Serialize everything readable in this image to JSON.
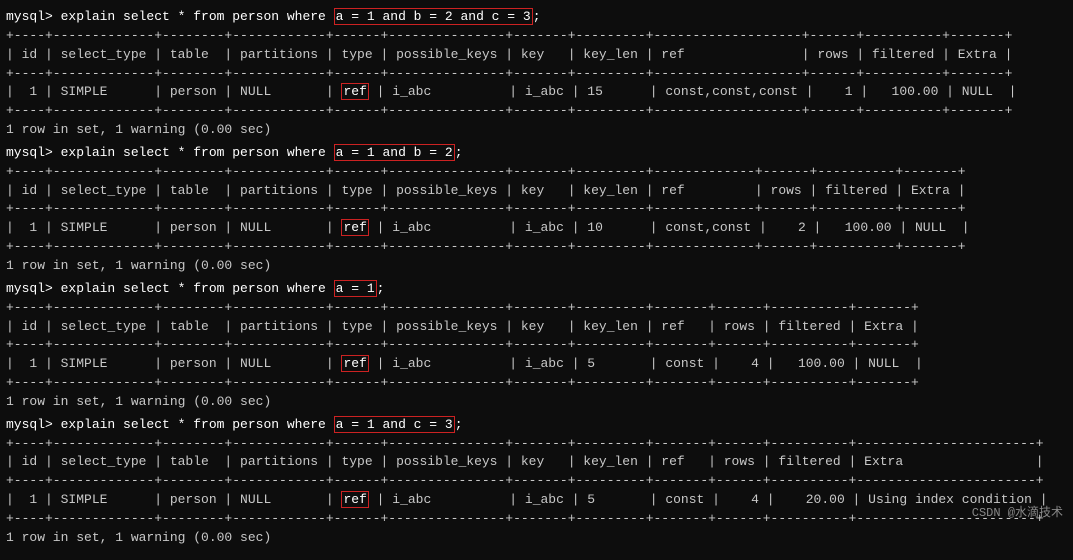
{
  "terminal": {
    "blocks": [
      {
        "id": "block1",
        "prompt": "mysql> explain select * from person where ",
        "highlight": "a = 1 and b = 2 and c = 3",
        "prompt_end": ";",
        "divider_top": "+----+-------------+--------+------------+------+---------------+-------+---------+-------------------+------+----------+-------+",
        "header": "| id | select_type | table  | partitions | type | possible_keys | key   | key_len | ref               | rows | filtered | Extra |",
        "divider_mid": "+----+-------------+--------+------------+------+---------------+-------+---------+-------------------+------+----------+-------+",
        "row_pre": "|  1 | SIMPLE      | person | NULL       | ",
        "ref_val": "ref",
        "row_post": " | i_abc          | i_abc | 15      | const,const,const |    1 |   100.00 | NULL  |",
        "divider_bot": "+----+-------------+--------+------------+------+---------------+-------+---------+-------------------+------+----------+-------+",
        "result": "1 row in set, 1 warning (0.00 sec)"
      },
      {
        "id": "block2",
        "prompt": "mysql> explain select * from person where ",
        "highlight": "a = 1 and b = 2",
        "prompt_end": ";",
        "divider_top": "+----+-------------+--------+------------+------+---------------+-------+---------+-------------+------+----------+-------+",
        "header": "| id | select_type | table  | partitions | type | possible_keys | key   | key_len | ref         | rows | filtered | Extra |",
        "divider_mid": "+----+-------------+--------+------------+------+---------------+-------+---------+-------------+------+----------+-------+",
        "row_pre": "|  1 | SIMPLE      | person | NULL       | ",
        "ref_val": "ref",
        "row_post": " | i_abc          | i_abc | 10      | const,const |    2 |   100.00 | NULL  |",
        "divider_bot": "+----+-------------+--------+------------+------+---------------+-------+---------+-------------+------+----------+-------+",
        "result": "1 row in set, 1 warning (0.00 sec)"
      },
      {
        "id": "block3",
        "prompt": "mysql> explain select * from person where ",
        "highlight": "a = 1",
        "prompt_end": ";",
        "divider_top": "+----+-------------+--------+------------+------+---------------+-------+---------+-------+------+----------+-------+",
        "header": "| id | select_type | table  | partitions | type | possible_keys | key   | key_len | ref   | rows | filtered | Extra |",
        "divider_mid": "+----+-------------+--------+------------+------+---------------+-------+---------+-------+------+----------+-------+",
        "row_pre": "|  1 | SIMPLE      | person | NULL       | ",
        "ref_val": "ref",
        "row_post": " | i_abc          | i_abc | 5       | const |    4 |   100.00 | NULL  |",
        "divider_bot": "+----+-------------+--------+------------+------+---------------+-------+---------+-------+------+----------+-------+",
        "result": "1 row in set, 1 warning (0.00 sec)"
      },
      {
        "id": "block4",
        "prompt": "mysql> explain select * from person where ",
        "highlight": "a = 1 and c = 3",
        "prompt_end": ";",
        "divider_top": "+----+-------------+--------+------------+------+---------------+-------+---------+-------+------+----------+-----------------------+",
        "header": "| id | select_type | table  | partitions | type | possible_keys | key   | key_len | ref   | rows | filtered | Extra                 |",
        "divider_mid": "+----+-------------+--------+------------+------+---------------+-------+---------+-------+------+----------+-----------------------+",
        "row_pre": "|  1 | SIMPLE      | person | NULL       | ",
        "ref_val": "ref",
        "row_post": " | i_abc          | i_abc | 5       | const |    4 |    20.00 | Using index condition |",
        "divider_bot": "+----+-------------+--------+------------+------+---------------+-------+---------+-------+------+----------+-----------------------+",
        "result": "1 row in set, 1 warning (0.00 sec)"
      }
    ],
    "watermark": "CSDN @水滴技术"
  }
}
